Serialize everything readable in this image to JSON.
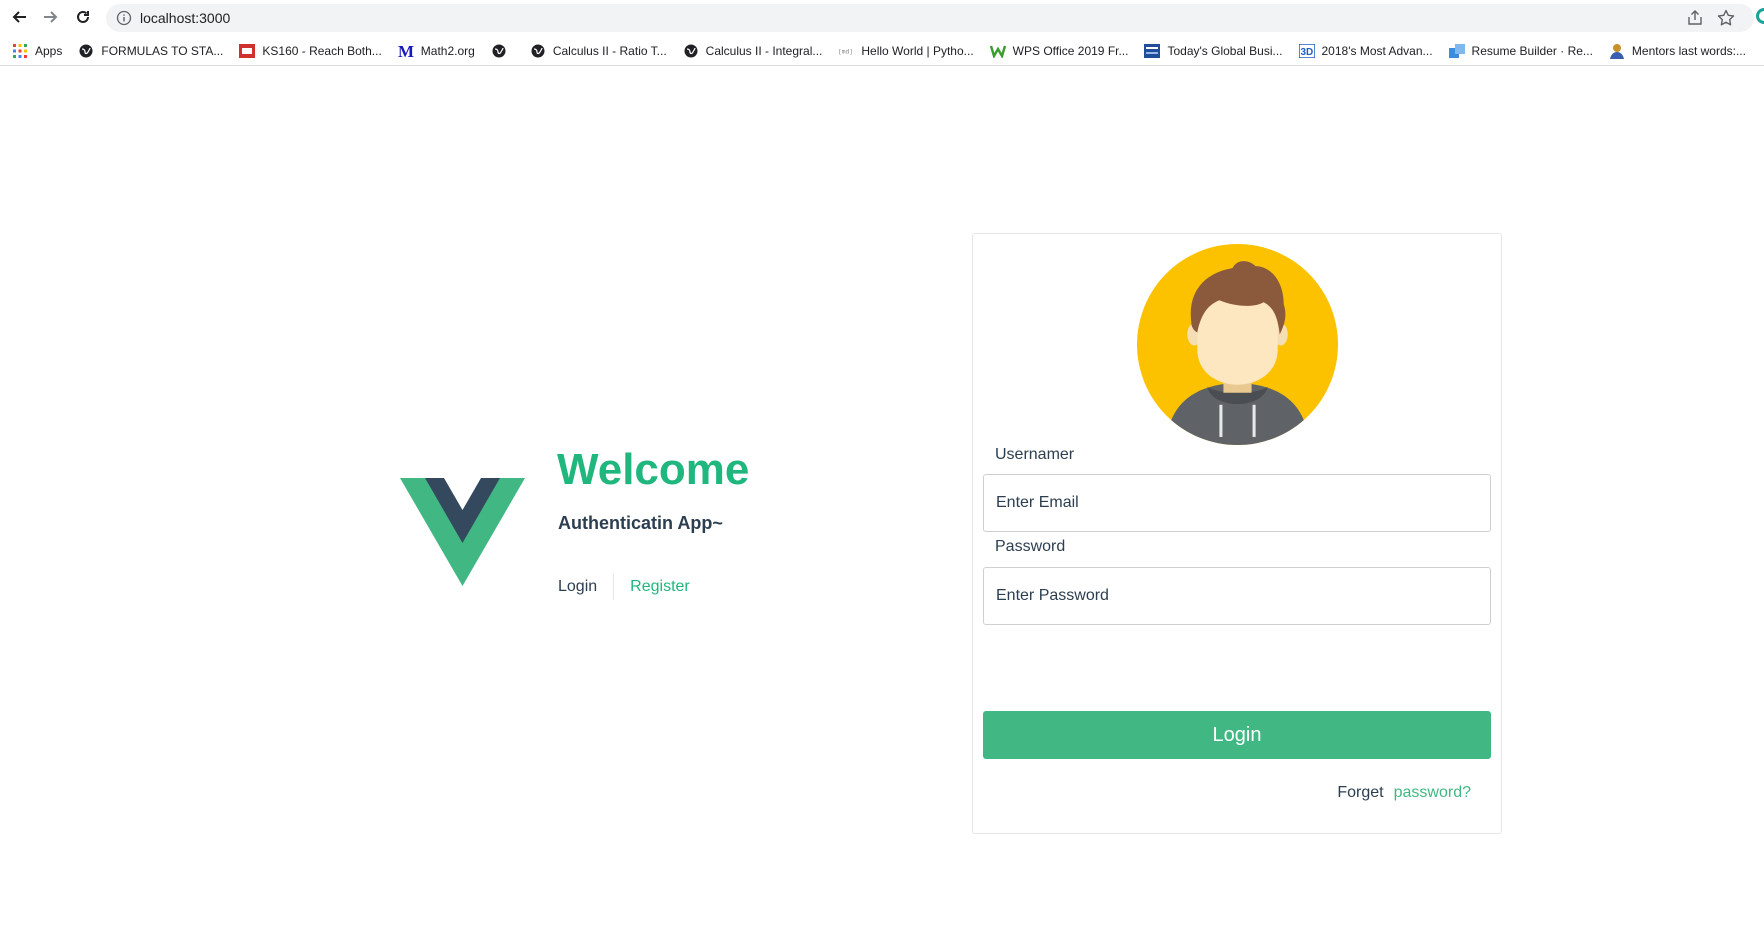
{
  "browser": {
    "url": "localhost:3000",
    "bookmarks": [
      {
        "label": "Apps",
        "icon": "apps-grid-icon"
      },
      {
        "label": "FORMULAS TO STA...",
        "icon": "globe-icon"
      },
      {
        "label": "KS160 - Reach Both...",
        "icon": "ks160-icon"
      },
      {
        "label": "Math2.org",
        "icon": "math2-m-icon"
      },
      {
        "label": "",
        "icon": "globe-icon"
      },
      {
        "label": "Calculus II - Ratio T...",
        "icon": "globe-icon"
      },
      {
        "label": "Calculus II - Integral...",
        "icon": "globe-icon"
      },
      {
        "label": "Hello World | Pytho...",
        "icon": "md-icon"
      },
      {
        "label": "WPS Office 2019 Fr...",
        "icon": "wps-icon"
      },
      {
        "label": "Today's Global Busi...",
        "icon": "news-icon"
      },
      {
        "label": "2018's Most Advan...",
        "icon": "3d-icon"
      },
      {
        "label": "Resume Builder · Re...",
        "icon": "resume-icon"
      },
      {
        "label": "Mentors last words:...",
        "icon": "mentor-icon"
      }
    ]
  },
  "hero": {
    "title": "Welcome",
    "subtitle": "Authenticatin App~",
    "links": {
      "login": "Login",
      "register": "Register"
    }
  },
  "form": {
    "username_label": "Usernamer",
    "email_placeholder": "Enter Email",
    "password_label": "Password",
    "password_placeholder": "Enter Password",
    "submit_label": "Login",
    "forget_text": "Forget",
    "forget_link": "password?"
  },
  "colors": {
    "accent": "#41b883",
    "title_green": "#1fb77d",
    "dark": "#2c3e50",
    "avatar_bg": "#fcc200"
  }
}
